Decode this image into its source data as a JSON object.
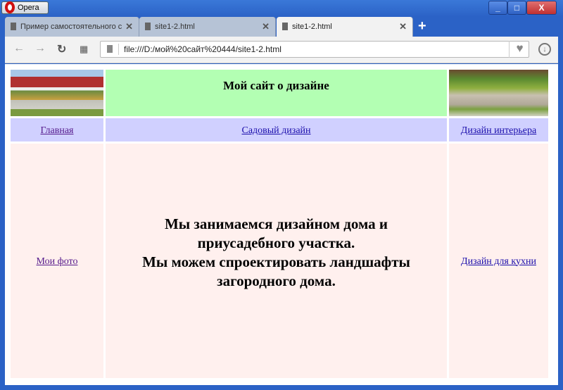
{
  "browser": {
    "app_button": "Opera",
    "address": "file:///D:/мой%20сайт%20444/site1-2.html",
    "tabs": [
      {
        "label": "Пример самостоятельного с"
      },
      {
        "label": "site1-2.html"
      },
      {
        "label": "site1-2.html",
        "active": true
      }
    ]
  },
  "page": {
    "header_title": "Мой сайт о дизайне",
    "nav": {
      "home": "Главная",
      "garden": "Садовый дизайн",
      "interior": "Дизайн интерьера"
    },
    "left_link": "Мои фото",
    "right_link": "Дизайн для кухни",
    "main_lines": [
      "Мы занимаемся дизайном дома и",
      "приусадебного участка.",
      "Мы можем спроектировать ландшафты",
      "загородного дома."
    ]
  },
  "colors": {
    "header_bg": "#b3ffb3",
    "nav_bg": "#d0d0ff",
    "content_bg": "#fff0ee",
    "frame": "#2b62c6"
  }
}
